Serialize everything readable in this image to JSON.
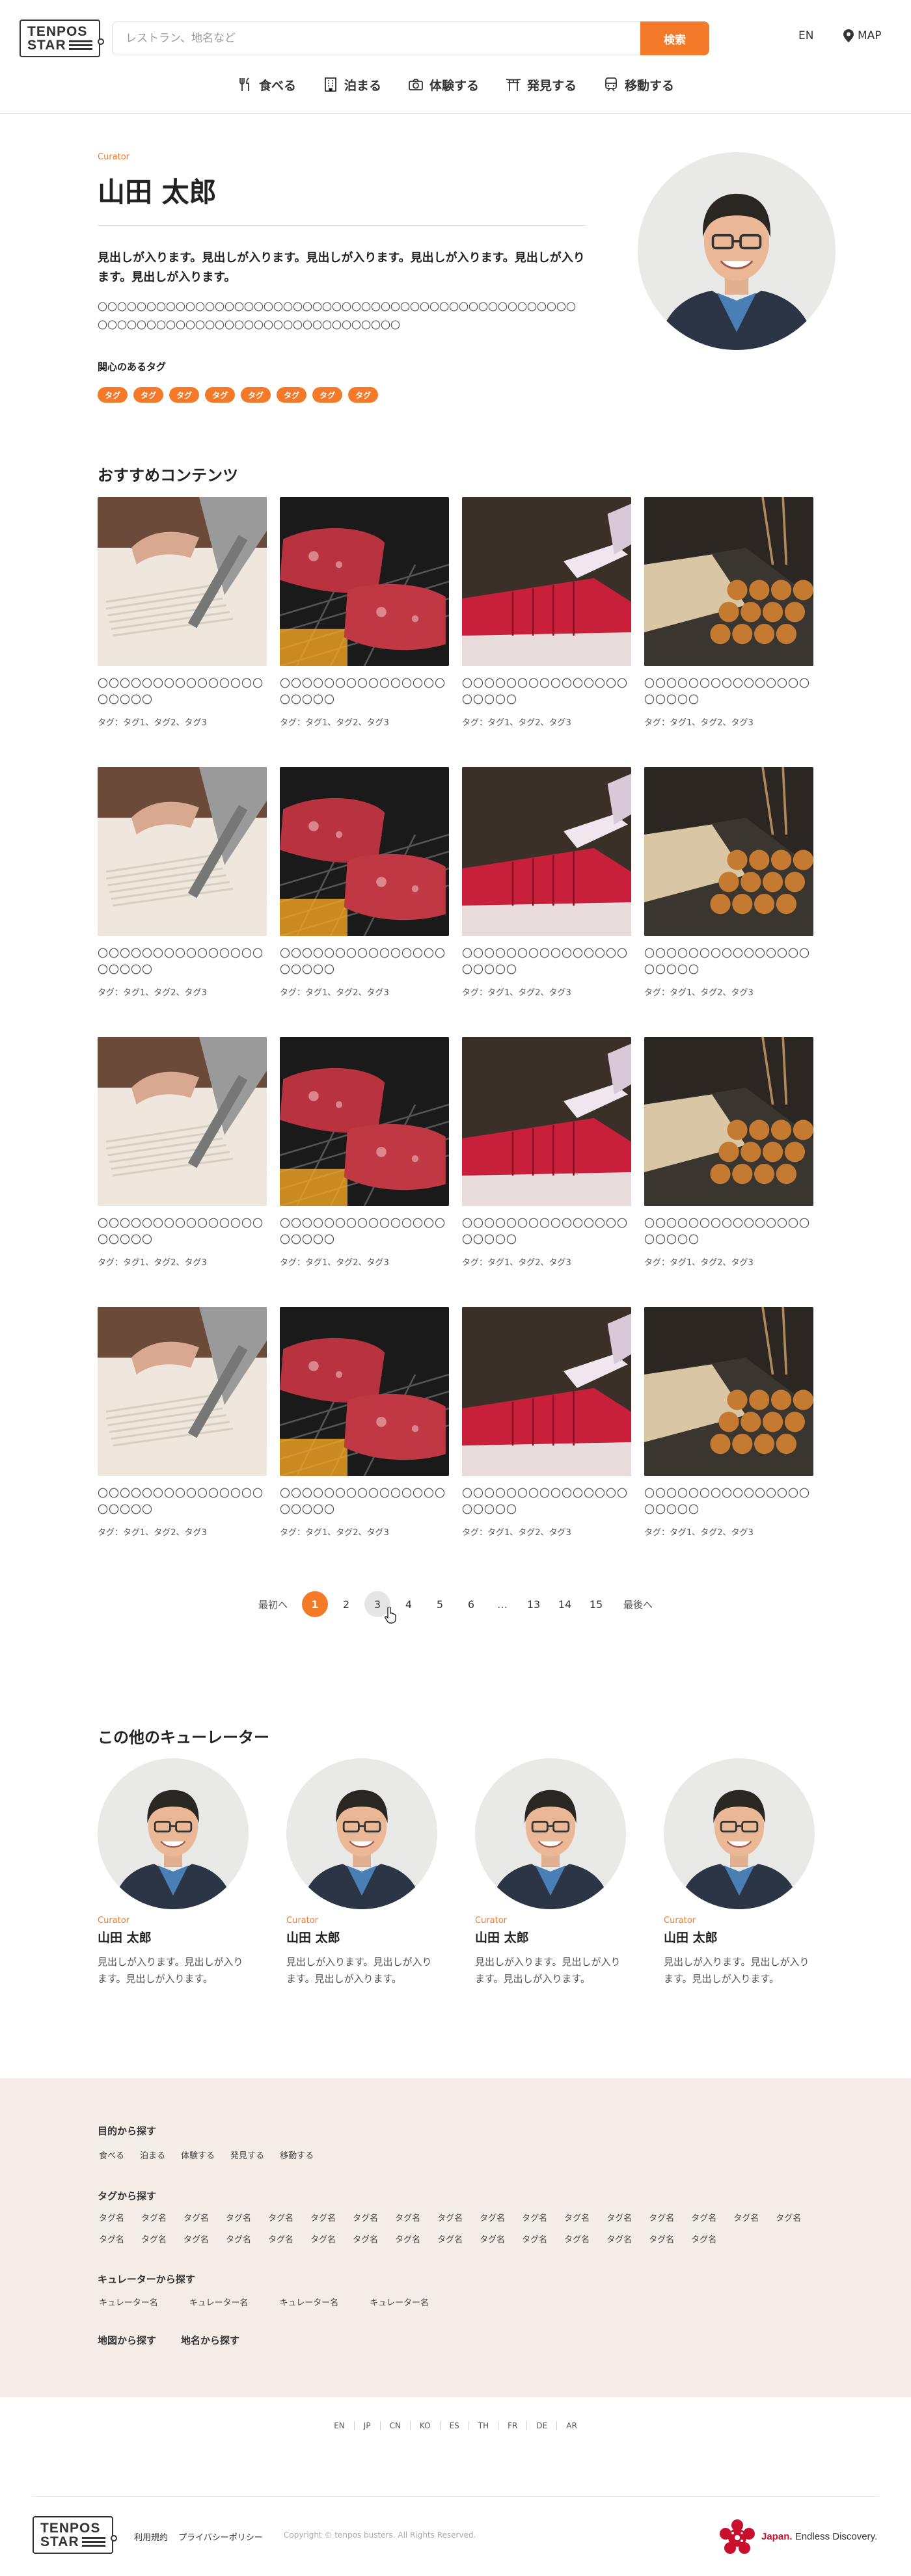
{
  "header": {
    "logo_line1": "TENPOS",
    "logo_line2": "STAR",
    "search_placeholder": "レストラン、地名など",
    "search_button": "検索",
    "lang": "EN",
    "map": "MAP",
    "nav": [
      {
        "label": "食べる",
        "icon": "fork-knife-icon"
      },
      {
        "label": "泊まる",
        "icon": "building-icon"
      },
      {
        "label": "体験する",
        "icon": "camera-icon"
      },
      {
        "label": "発見する",
        "icon": "torii-icon"
      },
      {
        "label": "移動する",
        "icon": "train-icon"
      }
    ]
  },
  "profile": {
    "label": "Curator",
    "name": "山田 太郎",
    "heading": "見出しが入ります。見出しが入ります。見出しが入ります。見出しが入ります。見出しが入ります。見出しが入ります。",
    "body": "〇〇〇〇〇〇〇〇〇〇〇〇〇〇〇〇〇〇〇〇〇〇〇〇〇〇〇〇〇〇〇〇〇〇〇〇〇〇〇〇〇〇〇〇〇〇〇〇〇〇〇〇〇〇〇〇〇〇〇〇〇〇〇〇〇〇〇〇〇〇〇〇〇〇〇〇〇〇〇〇",
    "tags_title": "関心のあるタグ",
    "tags": [
      "タグ",
      "タグ",
      "タグ",
      "タグ",
      "タグ",
      "タグ",
      "タグ",
      "タグ"
    ]
  },
  "recommended": {
    "title": "おすすめコンテンツ",
    "cards": [
      {
        "title": "〇〇〇〇〇〇〇〇〇〇〇〇〇〇〇〇〇〇〇〇",
        "tags": "タグ：タグ1、タグ2、タグ3",
        "image": "soba-noodles"
      },
      {
        "title": "〇〇〇〇〇〇〇〇〇〇〇〇〇〇〇〇〇〇〇〇",
        "tags": "タグ：タグ1、タグ2、タグ3",
        "image": "grilled-beef"
      },
      {
        "title": "〇〇〇〇〇〇〇〇〇〇〇〇〇〇〇〇〇〇〇〇",
        "tags": "タグ：タグ1、タグ2、タグ3",
        "image": "tuna-cutting"
      },
      {
        "title": "〇〇〇〇〇〇〇〇〇〇〇〇〇〇〇〇〇〇〇〇",
        "tags": "タグ：タグ1、タグ2、タグ3",
        "image": "takoyaki"
      },
      {
        "title": "〇〇〇〇〇〇〇〇〇〇〇〇〇〇〇〇〇〇〇〇",
        "tags": "タグ：タグ1、タグ2、タグ3",
        "image": "soba-noodles"
      },
      {
        "title": "〇〇〇〇〇〇〇〇〇〇〇〇〇〇〇〇〇〇〇〇",
        "tags": "タグ：タグ1、タグ2、タグ3",
        "image": "grilled-beef"
      },
      {
        "title": "〇〇〇〇〇〇〇〇〇〇〇〇〇〇〇〇〇〇〇〇",
        "tags": "タグ：タグ1、タグ2、タグ3",
        "image": "tuna-cutting"
      },
      {
        "title": "〇〇〇〇〇〇〇〇〇〇〇〇〇〇〇〇〇〇〇〇",
        "tags": "タグ：タグ1、タグ2、タグ3",
        "image": "takoyaki"
      },
      {
        "title": "〇〇〇〇〇〇〇〇〇〇〇〇〇〇〇〇〇〇〇〇",
        "tags": "タグ：タグ1、タグ2、タグ3",
        "image": "soba-noodles"
      },
      {
        "title": "〇〇〇〇〇〇〇〇〇〇〇〇〇〇〇〇〇〇〇〇",
        "tags": "タグ：タグ1、タグ2、タグ3",
        "image": "grilled-beef"
      },
      {
        "title": "〇〇〇〇〇〇〇〇〇〇〇〇〇〇〇〇〇〇〇〇",
        "tags": "タグ：タグ1、タグ2、タグ3",
        "image": "tuna-cutting"
      },
      {
        "title": "〇〇〇〇〇〇〇〇〇〇〇〇〇〇〇〇〇〇〇〇",
        "tags": "タグ：タグ1、タグ2、タグ3",
        "image": "takoyaki"
      },
      {
        "title": "〇〇〇〇〇〇〇〇〇〇〇〇〇〇〇〇〇〇〇〇",
        "tags": "タグ：タグ1、タグ2、タグ3",
        "image": "soba-noodles"
      },
      {
        "title": "〇〇〇〇〇〇〇〇〇〇〇〇〇〇〇〇〇〇〇〇",
        "tags": "タグ：タグ1、タグ2、タグ3",
        "image": "grilled-beef"
      },
      {
        "title": "〇〇〇〇〇〇〇〇〇〇〇〇〇〇〇〇〇〇〇〇",
        "tags": "タグ：タグ1、タグ2、タグ3",
        "image": "tuna-cutting"
      },
      {
        "title": "〇〇〇〇〇〇〇〇〇〇〇〇〇〇〇〇〇〇〇〇",
        "tags": "タグ：タグ1、タグ2、タグ3",
        "image": "takoyaki"
      }
    ]
  },
  "pagination": {
    "first": "最初へ",
    "last": "最後へ",
    "pages": [
      "1",
      "2",
      "3",
      "4",
      "5",
      "6",
      "13",
      "14",
      "15"
    ],
    "current": "1",
    "ellipsis": "…"
  },
  "others": {
    "title": "この他のキューレーター",
    "curators": [
      {
        "label": "Curator",
        "name": "山田 太郎",
        "desc": "見出しが入ります。見出しが入ります。見出しが入ります。"
      },
      {
        "label": "Curator",
        "name": "山田 太郎",
        "desc": "見出しが入ります。見出しが入ります。見出しが入ります。"
      },
      {
        "label": "Curator",
        "name": "山田 太郎",
        "desc": "見出しが入ります。見出しが入ります。見出しが入ります。"
      },
      {
        "label": "Curator",
        "name": "山田 太郎",
        "desc": "見出しが入ります。見出しが入ります。見出しが入ります。"
      }
    ]
  },
  "sitemap": {
    "purpose_title": "目的から探す",
    "purpose_links": [
      "食べる",
      "泊まる",
      "体験する",
      "発見する",
      "移動する"
    ],
    "tag_title": "タグから探す",
    "tag_links": [
      "タグ名",
      "タグ名",
      "タグ名",
      "タグ名",
      "タグ名",
      "タグ名",
      "タグ名",
      "タグ名",
      "タグ名",
      "タグ名",
      "タグ名",
      "タグ名",
      "タグ名",
      "タグ名",
      "タグ名",
      "タグ名",
      "タグ名",
      "タグ名",
      "タグ名",
      "タグ名",
      "タグ名",
      "タグ名",
      "タグ名",
      "タグ名",
      "タグ名",
      "タグ名",
      "タグ名",
      "タグ名",
      "タグ名",
      "タグ名",
      "タグ名",
      "タグ名"
    ],
    "curator_title": "キュレーターから探す",
    "curator_links": [
      "キュレーター名",
      "キュレーター名",
      "キュレーター名",
      "キュレーター名"
    ],
    "map_link": "地図から探す",
    "place_link": "地名から探す"
  },
  "languages": [
    "EN",
    "JP",
    "CN",
    "KO",
    "ES",
    "TH",
    "FR",
    "DE",
    "AR"
  ],
  "footer": {
    "terms": "利用規約",
    "privacy": "プライバシーポリシー",
    "copyright": "Copyright © tenpos busters. All Rights Reserved.",
    "japan_brand": "Japan.",
    "japan_tagline": "Endless Discovery."
  },
  "colors": {
    "accent": "#f47a2a",
    "footer_bg": "#f4ece7"
  }
}
